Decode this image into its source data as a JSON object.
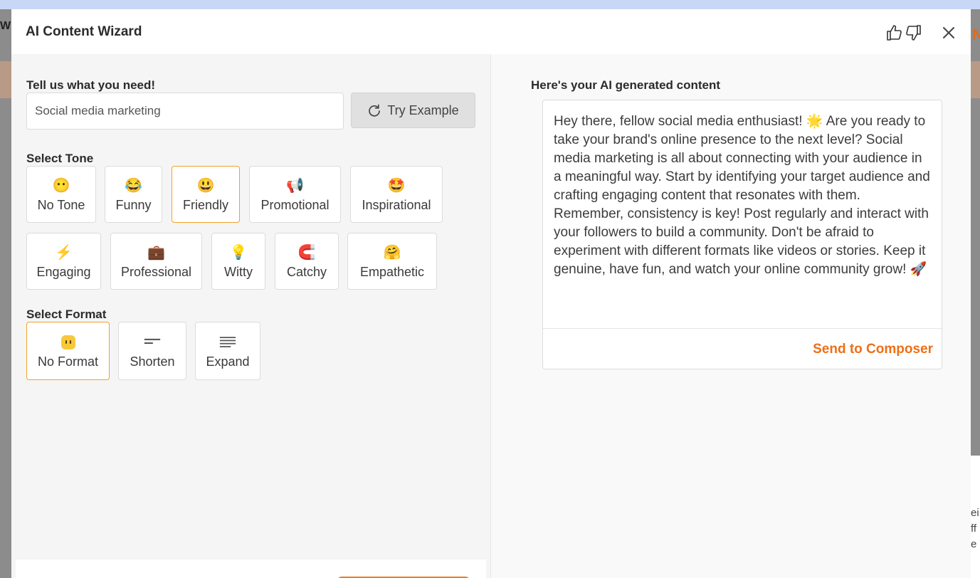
{
  "backdrop": {
    "left_text": "W",
    "right_text": "N",
    "right_panel_text": "ei ff e"
  },
  "modal": {
    "title": "AI Content Wizard"
  },
  "prompt": {
    "label": "Tell us what you need!",
    "value": "Social media marketing",
    "try_example_label": "Try Example"
  },
  "tone": {
    "label": "Select Tone",
    "selected": "Friendly",
    "options": [
      {
        "label": "No Tone",
        "emoji": "😶"
      },
      {
        "label": "Funny",
        "emoji": "😂"
      },
      {
        "label": "Friendly",
        "emoji": "😃"
      },
      {
        "label": "Promotional",
        "emoji": "📢"
      },
      {
        "label": "Inspirational",
        "emoji": "🤩"
      },
      {
        "label": "Engaging",
        "emoji": "⚡"
      },
      {
        "label": "Professional",
        "emoji": "💼"
      },
      {
        "label": "Witty",
        "emoji": "💡"
      },
      {
        "label": "Catchy",
        "emoji": "🧲"
      },
      {
        "label": "Empathetic",
        "emoji": "🤗"
      }
    ]
  },
  "format": {
    "label": "Select Format",
    "selected": "No Format",
    "options": [
      {
        "label": "No Format",
        "icon": "no-format-face-icon"
      },
      {
        "label": "Shorten",
        "icon": "shorten-lines-icon"
      },
      {
        "label": "Expand",
        "icon": "expand-lines-icon"
      }
    ]
  },
  "output": {
    "label": "Here's your AI generated content",
    "content": "Hey there, fellow social media enthusiast! 🌟 Are you ready to take your brand's online presence to the next level? Social media marketing is all about connecting with your audience in a meaningful way. Start by identifying your target audience and crafting engaging content that resonates with them. Remember, consistency is key! Post regularly and interact with your followers to build a community. Don't be afraid to experiment with different formats like videos or stories. Keep it genuine, have fun, and watch your online community grow! 🚀",
    "send_label": "Send to Composer"
  },
  "colors": {
    "accent": "#ee6f16",
    "selected_border": "#f2a22b"
  }
}
